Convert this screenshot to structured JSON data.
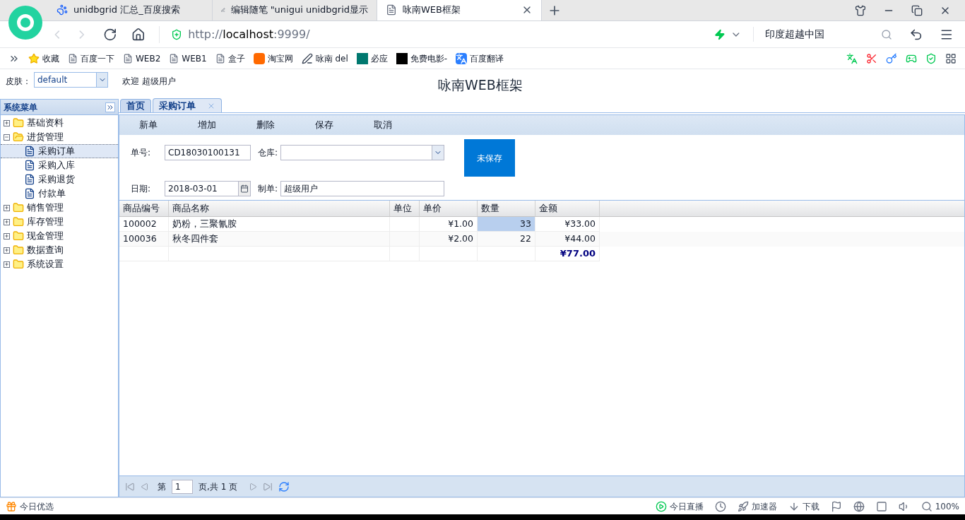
{
  "browser": {
    "tabs": [
      {
        "title": "unidbgrid 汇总_百度搜索",
        "kind": "paw",
        "selected": false
      },
      {
        "title": "编辑随笔 \"unigui unidbgrid显示",
        "kind": "blog",
        "selected": false
      },
      {
        "title": "咏南WEB框架",
        "kind": "page",
        "selected": true
      }
    ],
    "url_prefix": "http://",
    "url_host": "localhost",
    "url_rest": ":9999/",
    "search": "印度超越中国",
    "bookmarks": [
      {
        "label": "收藏",
        "kind": "star"
      },
      {
        "label": "百度一下",
        "kind": "page"
      },
      {
        "label": "WEB2",
        "kind": "page"
      },
      {
        "label": "WEB1",
        "kind": "page"
      },
      {
        "label": "盒子",
        "kind": "page"
      },
      {
        "label": "淘宝网",
        "kind": "taobao"
      },
      {
        "label": "咏南 del",
        "kind": "blog"
      },
      {
        "label": "必应",
        "kind": "bing"
      },
      {
        "label": "免费电影-",
        "kind": "ck"
      },
      {
        "label": "百度翻译",
        "kind": "translate"
      }
    ]
  },
  "header": {
    "skin_label": "皮肤：",
    "skin_value": "default",
    "welcome": "欢迎 超级用户",
    "title": "咏南WEB框架"
  },
  "sidebar": {
    "title": "系统菜单",
    "items": [
      {
        "label": "基础资料",
        "expanded": false,
        "selected": false
      },
      {
        "label": "进货管理",
        "expanded": true,
        "selected": false,
        "children": [
          {
            "label": "采购订单",
            "selected": true
          },
          {
            "label": "采购入库",
            "selected": false
          },
          {
            "label": "采购退货",
            "selected": false
          },
          {
            "label": "付款单",
            "selected": false
          }
        ]
      },
      {
        "label": "销售管理",
        "expanded": false,
        "selected": false
      },
      {
        "label": "库存管理",
        "expanded": false,
        "selected": false
      },
      {
        "label": "现金管理",
        "expanded": false,
        "selected": false
      },
      {
        "label": "数据查询",
        "expanded": false,
        "selected": false
      },
      {
        "label": "系统设置",
        "expanded": false,
        "selected": false
      }
    ]
  },
  "tabs": [
    {
      "label": "首页",
      "selected": false,
      "closable": false
    },
    {
      "label": "采购订单",
      "selected": true,
      "closable": true
    }
  ],
  "toolbar": [
    "新单",
    "增加",
    "删除",
    "保存",
    "取消"
  ],
  "form": {
    "number_label": "单号:",
    "number": "CD18030100131",
    "warehouse_label": "仓库:",
    "date_label": "日期:",
    "date": "2018-03-01",
    "maker_label": "制单:",
    "maker": "超级用户",
    "status": "未保存"
  },
  "table": {
    "columns": [
      "商品编号",
      "商品名称",
      "单位",
      "单价",
      "数量",
      "金额"
    ],
    "rows": [
      {
        "kind": "item",
        "cells": [
          {
            "text": "100002",
            "selected": false
          },
          {
            "text": "奶粉，三聚氰胺",
            "selected": false
          },
          {
            "text": "",
            "selected": false
          },
          {
            "text": "¥1.00",
            "selected": false
          },
          {
            "text": "33",
            "selected": true
          },
          {
            "text": "¥33.00",
            "selected": false
          }
        ]
      },
      {
        "kind": "item",
        "cells": [
          {
            "text": "100036",
            "selected": false
          },
          {
            "text": "秋冬四件套",
            "selected": false
          },
          {
            "text": "",
            "selected": false
          },
          {
            "text": "¥2.00",
            "selected": false
          },
          {
            "text": "22",
            "selected": false
          },
          {
            "text": "¥44.00",
            "selected": false
          }
        ]
      },
      {
        "kind": "total",
        "cells": [
          {
            "text": "",
            "selected": false
          },
          {
            "text": "",
            "selected": false
          },
          {
            "text": "",
            "selected": false
          },
          {
            "text": "",
            "selected": false
          },
          {
            "text": "",
            "selected": false
          },
          {
            "text": "¥77.00",
            "selected": false
          }
        ]
      }
    ]
  },
  "pager": {
    "before": "第",
    "page": "1",
    "after": "页,共 1 页"
  },
  "status_bar": {
    "left": "今日优选",
    "items": [
      {
        "label": "今日直播",
        "kind": "live"
      },
      {
        "kind": "clock"
      },
      {
        "label": "加速器",
        "kind": "rocket"
      },
      {
        "label": "下载",
        "kind": "download"
      },
      {
        "kind": "flag"
      },
      {
        "kind": "ie"
      },
      {
        "kind": "window"
      },
      {
        "kind": "sound"
      },
      {
        "label": "100%",
        "kind": "zoom"
      }
    ]
  }
}
